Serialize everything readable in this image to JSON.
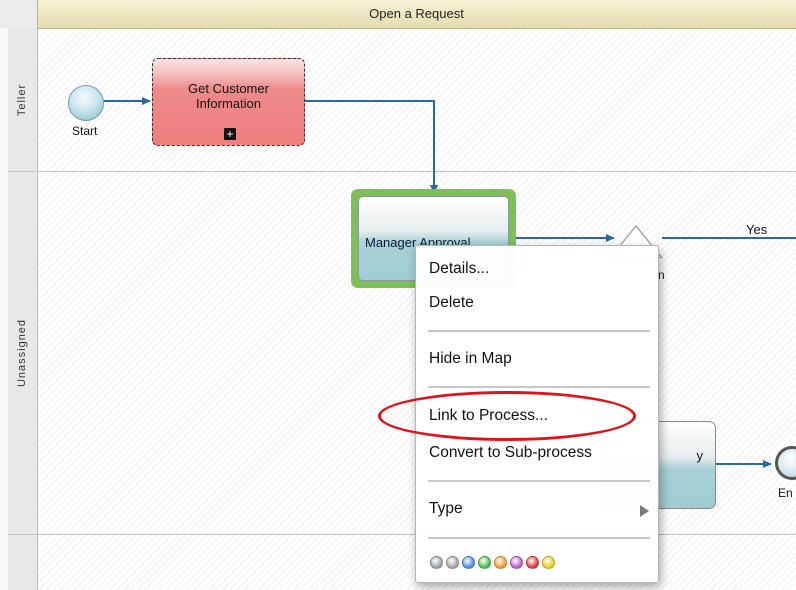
{
  "pool": {
    "title": "Open a Request"
  },
  "lanes": [
    {
      "label": "Teller"
    },
    {
      "label": "Unassigned"
    }
  ],
  "diagram": {
    "start_event_label": "Start",
    "task_customer_label": "Get Customer\nInformation",
    "task_approval_label_selected": "Manager Approval",
    "task_right_partial_label": "y",
    "gateway_yes_label": "Yes",
    "gateway_partial_label": "n",
    "end_event_partial_label": "En"
  },
  "context_menu": {
    "items": [
      {
        "label": "Details..."
      },
      {
        "label": "Delete"
      },
      {
        "label": "Hide in Map"
      },
      {
        "label": "Link to Process..."
      },
      {
        "label": "Convert to Sub-process"
      },
      {
        "label": "Type"
      }
    ],
    "color_swatches": [
      "#9aa7ad",
      "#a8a8a8",
      "#4a90d9",
      "#4fbf4f",
      "#f0a030",
      "#c060c8",
      "#e03c3c",
      "#f0d020"
    ]
  },
  "colors": {
    "selection_frame": "#7fbf58",
    "annotation": "#e0131b",
    "flow": "#2a6aa0",
    "task_red": "#ef7f7f",
    "task_teal": "#9fcdd3"
  }
}
